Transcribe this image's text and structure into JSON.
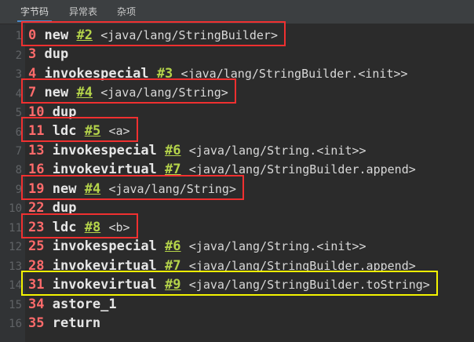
{
  "tabs": [
    {
      "label": "字节码",
      "active": true
    },
    {
      "label": "异常表",
      "active": false
    },
    {
      "label": "杂项",
      "active": false
    }
  ],
  "line_numbers": [
    "1",
    "2",
    "3",
    "4",
    "5",
    "6",
    "7",
    "8",
    "9",
    "10",
    "11",
    "12",
    "13",
    "14",
    "15",
    "16"
  ],
  "instructions": [
    {
      "offset": "0",
      "op": "new",
      "ref": "#2",
      "arg": "<java/lang/StringBuilder>"
    },
    {
      "offset": "3",
      "op": "dup",
      "ref": "",
      "arg": ""
    },
    {
      "offset": "4",
      "op": "invokespecial",
      "ref": "#3",
      "arg": "<java/lang/StringBuilder.<init>>"
    },
    {
      "offset": "7",
      "op": "new",
      "ref": "#4",
      "arg": "<java/lang/String>"
    },
    {
      "offset": "10",
      "op": "dup",
      "ref": "",
      "arg": ""
    },
    {
      "offset": "11",
      "op": "ldc",
      "ref": "#5",
      "arg": "<a>"
    },
    {
      "offset": "13",
      "op": "invokespecial",
      "ref": "#6",
      "arg": "<java/lang/String.<init>>"
    },
    {
      "offset": "16",
      "op": "invokevirtual",
      "ref": "#7",
      "arg": "<java/lang/StringBuilder.append>"
    },
    {
      "offset": "19",
      "op": "new",
      "ref": "#4",
      "arg": "<java/lang/String>"
    },
    {
      "offset": "22",
      "op": "dup",
      "ref": "",
      "arg": ""
    },
    {
      "offset": "23",
      "op": "ldc",
      "ref": "#8",
      "arg": "<b>"
    },
    {
      "offset": "25",
      "op": "invokespecial",
      "ref": "#6",
      "arg": "<java/lang/String.<init>>"
    },
    {
      "offset": "28",
      "op": "invokevirtual",
      "ref": "#7",
      "arg": "<java/lang/StringBuilder.append>"
    },
    {
      "offset": "31",
      "op": "invokevirtual",
      "ref": "#9",
      "arg": "<java/lang/StringBuilder.toString>"
    },
    {
      "offset": "34",
      "op": "astore_1",
      "ref": "",
      "arg": ""
    },
    {
      "offset": "35",
      "op": "return",
      "ref": "",
      "arg": ""
    }
  ],
  "highlights": [
    {
      "instruction": 0,
      "color": "#f03030"
    },
    {
      "instruction": 3,
      "color": "#f03030"
    },
    {
      "instruction": 5,
      "color": "#f03030"
    },
    {
      "instruction": 8,
      "color": "#f03030"
    },
    {
      "instruction": 10,
      "color": "#f03030"
    },
    {
      "instruction": 13,
      "color": "#f4f400"
    }
  ]
}
